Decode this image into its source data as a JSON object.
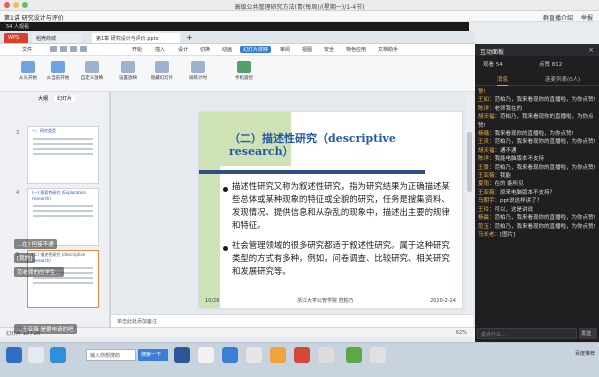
{
  "window": {
    "title": "高级公共管理研究方法(青(每周)/(星期一)/1-4节)",
    "exit_label": "退出"
  },
  "classbar": {
    "course": "第1讲 研究设计与评价",
    "right_items": [
      "群直播介绍",
      "举报"
    ]
  },
  "stream": {
    "text": "54 人观看"
  },
  "tabs": {
    "wps": "WPS",
    "docs": "稻壳商城",
    "current": "第1章 研究设计与评价.pptx",
    "add": "+"
  },
  "menu": {
    "items": [
      "文件",
      "开始",
      "插入",
      "设计",
      "切换",
      "动画",
      "幻灯片放映",
      "审阅",
      "视图",
      "安全",
      "特色应用",
      "文档助手"
    ],
    "active": "幻灯片放映"
  },
  "ribbon": {
    "buttons": [
      "从头开始",
      "从当前开始",
      "自定义放映",
      "设置放映",
      "隐藏幻灯片",
      "排练计时",
      "手机遥控"
    ]
  },
  "leftpanel": {
    "tabs": [
      "大纲",
      "幻灯片"
    ],
    "active_tab": "幻灯片",
    "thumbs": [
      {
        "num": "3",
        "title": "一、研究类型"
      },
      {
        "num": "4",
        "title": "(一) 探索性研究 (Exploration research)"
      },
      {
        "num": "5",
        "title": "(二) 描述性研究 (descriptive research)"
      }
    ]
  },
  "slide": {
    "title": "（二）描述性研究（descriptive research）",
    "para1": "描述性研究又称为叙述性研究，指为研究结果为正确描述某些总体或某种现象的特征或全貌的研究，任务是搜集资料、发现情况、提供信息和从杂乱的现象中，描述出主要的规律和特征。",
    "para2": "社会管理领域的很多研究都适于叙述性研究。属于这种研究类型的方式有多种，例如，问卷调查、比较研究、相关研究和发展研究等。",
    "page_number": "10/26",
    "footer": "浙江大学公管学院 范柏乃",
    "date": "2020-2-24"
  },
  "notes": {
    "placeholder": "单击此处添加备注"
  },
  "status": {
    "zoom": "62%",
    "slide_info": "幻灯片 10 / 26"
  },
  "overlay": [
    "...在] 但接不通",
    "[我的]",
    "范老师的的学生...",
    "...王亚薇 是要申请的吧"
  ],
  "taskbar": {
    "search_placeholder": "输入你想搜的",
    "search_button": "搜索一下",
    "sys": "百度推荐"
  },
  "chat": {
    "header": "互动面板",
    "viewers_label": "观看 54",
    "likes_label": "点赞 812",
    "tabs": [
      "消息",
      "连麦列表(0人)"
    ],
    "active_tab": "消息",
    "input_placeholder": "说点什么...",
    "send_label": "发送",
    "messages": [
      {
        "who": "",
        "text": "警!"
      },
      {
        "who": "王如：",
        "text": "范柏乃，我来看现你的直播啦，为你点赞!"
      },
      {
        "who": "陈洋：",
        "text": "老师我在的"
      },
      {
        "who": "胡天福：",
        "text": "范柏乃，我来看现你的直播啦，为你点赞!"
      },
      {
        "who": "杨璐：",
        "text": "我来看现你的直播啦，为你点赞!"
      },
      {
        "who": "王灵：",
        "text": "范柏乃，我来看现你的直播啦，为你点赞!"
      },
      {
        "who": "胡天福：",
        "text": "通不通"
      },
      {
        "who": "陈洋：",
        "text": "我能电脑版本不支持"
      },
      {
        "who": "王景：",
        "text": "范柏乃，我来看现你的直播啦，为你点赞!"
      },
      {
        "who": "王亚薇：",
        "text": "我能"
      },
      {
        "who": "夏雨：",
        "text": "在的 能听见"
      },
      {
        "who": "王亚薇：",
        "text": "原来电脑版本不支持？"
      },
      {
        "who": "马朝宇：",
        "text": "ppt说这样讲了？"
      },
      {
        "who": "王玲：",
        "text": "可以，这是讲说"
      },
      {
        "who": "杨晨：",
        "text": "范柏乃，我来看现你的直播啦，为你点赞!"
      },
      {
        "who": "范玉：",
        "text": "范柏乃，我来看现你的直播啦，为你点赞!"
      },
      {
        "who": "马长老：",
        "text": "[图片]"
      }
    ]
  }
}
